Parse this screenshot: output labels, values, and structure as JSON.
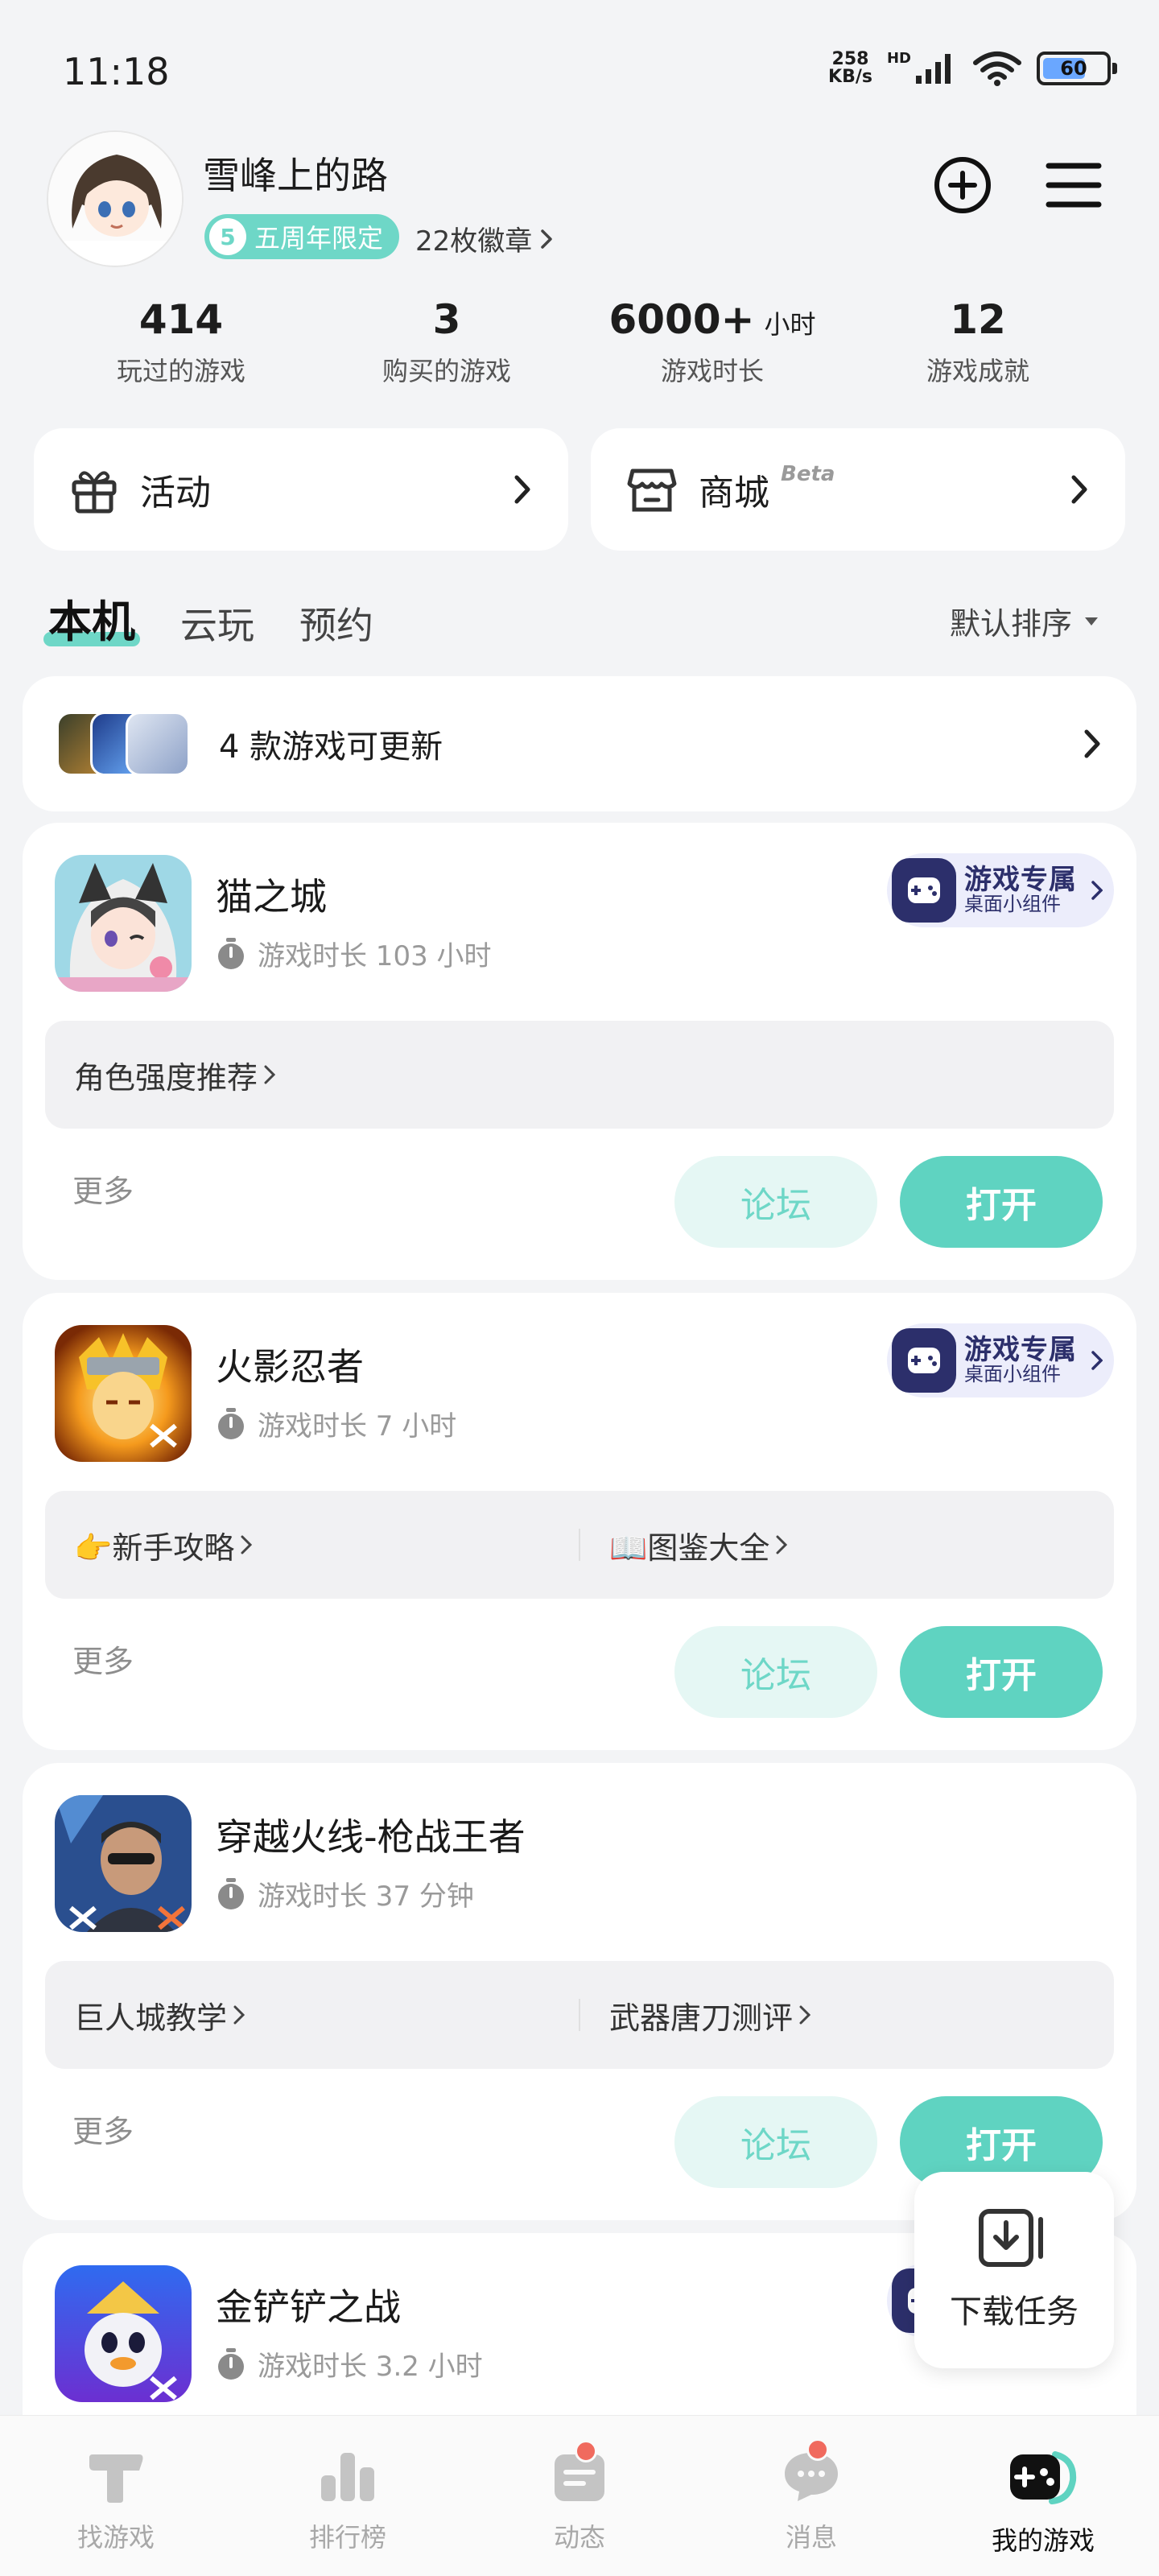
{
  "status_bar": {
    "time": "11:18",
    "net_speed_value": "258",
    "net_speed_unit": "KB/s",
    "hd": "HD",
    "battery": "60"
  },
  "profile": {
    "username": "雪峰上的路",
    "badge_number": "5",
    "badge_label": "五周年限定",
    "medals": "22枚徽章"
  },
  "stats": [
    {
      "value": "414",
      "unit": "",
      "label": "玩过的游戏"
    },
    {
      "value": "3",
      "unit": "",
      "label": "购买的游戏"
    },
    {
      "value": "6000+",
      "unit": "小时",
      "label": "游戏时长"
    },
    {
      "value": "12",
      "unit": "",
      "label": "游戏成就"
    }
  ],
  "entries": {
    "activity": "活动",
    "store": "商城",
    "store_beta": "Beta"
  },
  "tabs": [
    "本机",
    "云玩",
    "预约"
  ],
  "sort_label": "默认排序",
  "update_banner": "4 款游戏可更新",
  "widget": {
    "line1": "游戏专属",
    "line2": "桌面小组件"
  },
  "games": [
    {
      "title": "猫之城",
      "playtime": "游戏时长 103 小时",
      "links": [
        "角色强度推荐"
      ],
      "more": "更多",
      "forum": "论坛",
      "open": "打开"
    },
    {
      "title": "火影忍者",
      "playtime": "游戏时长 7 小时",
      "links": [
        "👉新手攻略",
        "📖图鉴大全"
      ],
      "more": "更多",
      "forum": "论坛",
      "open": "打开"
    },
    {
      "title": "穿越火线-枪战王者",
      "playtime": "游戏时长 37 分钟",
      "links": [
        "巨人城教学",
        "武器唐刀测评"
      ],
      "more": "更多",
      "forum": "论坛",
      "open": "打开"
    },
    {
      "title": "金铲铲之战",
      "playtime": "游戏时长 3.2 小时"
    }
  ],
  "download_task": "下载任务",
  "bottom_nav": [
    "找游戏",
    "排行榜",
    "动态",
    "消息",
    "我的游戏"
  ],
  "colors": {
    "accent": "#5fd3c1",
    "accent_light": "#e5f7f4",
    "widget_dark": "#2c2f6b",
    "notification": "#f06a5e"
  }
}
